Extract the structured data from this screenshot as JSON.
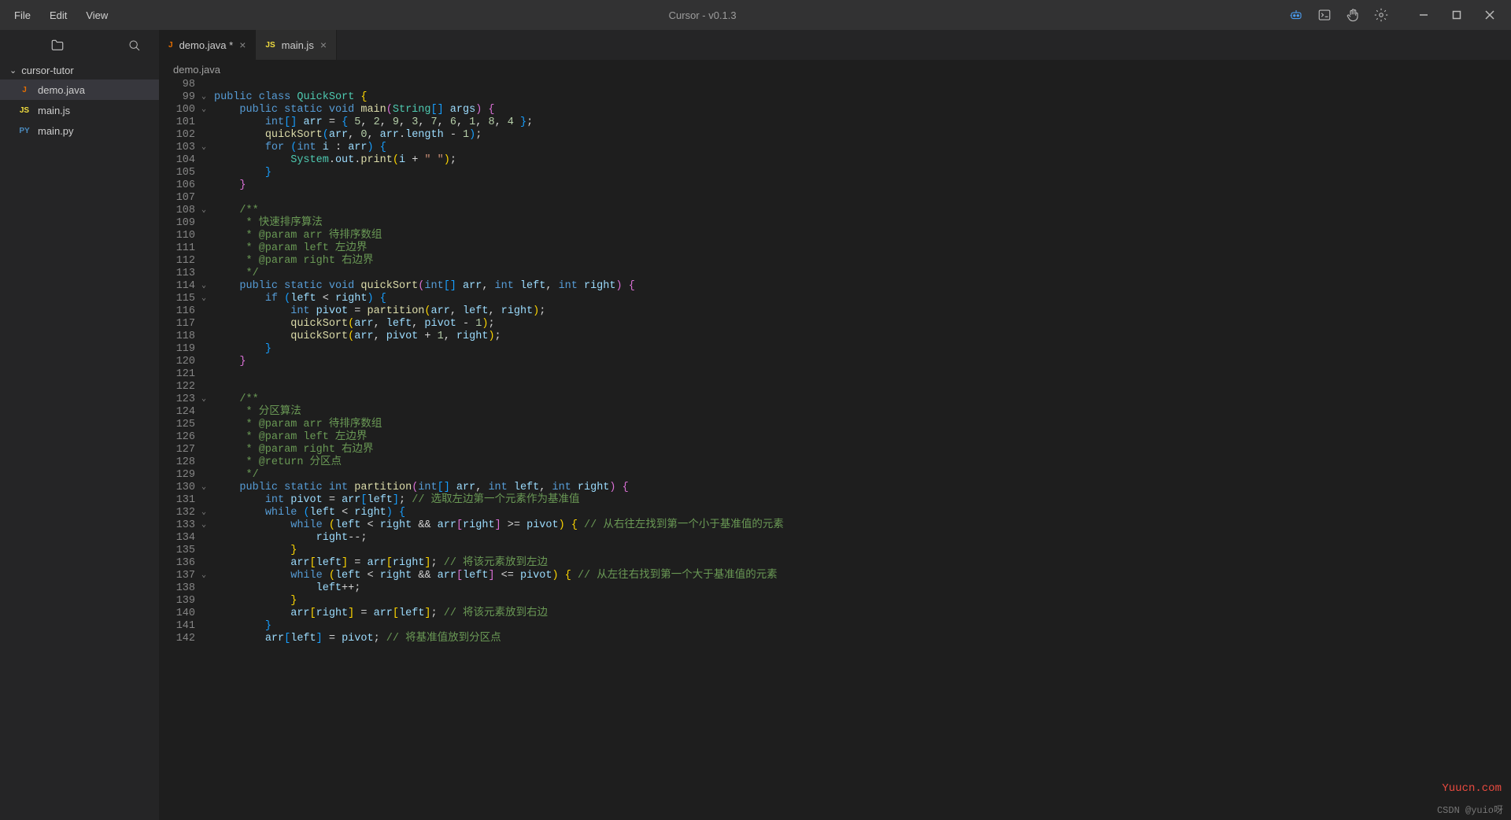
{
  "title": "Cursor - v0.1.3",
  "menu": {
    "file": "File",
    "edit": "Edit",
    "view": "View"
  },
  "sidebar": {
    "folder": "cursor-tutor",
    "files": [
      {
        "lang": "J",
        "name": "demo.java",
        "cls": "lang-j"
      },
      {
        "lang": "JS",
        "name": "main.js",
        "cls": "lang-js"
      },
      {
        "lang": "PY",
        "name": "main.py",
        "cls": "lang-py"
      }
    ]
  },
  "tabs": [
    {
      "lang": "J",
      "cls": "lang-j",
      "label": "demo.java *",
      "active": true
    },
    {
      "lang": "JS",
      "cls": "lang-js",
      "label": "main.js",
      "active": false
    }
  ],
  "breadcrumb": "demo.java",
  "line_start": 98,
  "line_end": 142,
  "fold_lines": [
    99,
    100,
    103,
    108,
    114,
    115,
    123,
    130,
    132,
    133,
    137
  ],
  "code": [
    "",
    "<span class='kw'>public</span> <span class='kw'>class</span> <span class='cls'>QuickSort</span> <span class='brace-y'>{</span>",
    "    <span class='kw'>public</span> <span class='kw'>static</span> <span class='kw'>void</span> <span class='fn'>main</span><span class='brace-p'>(</span><span class='cls'>String</span><span class='brace-b'>[]</span> <span class='param'>args</span><span class='brace-p'>)</span> <span class='brace-p'>{</span>",
    "        <span class='type'>int</span><span class='brace-b'>[]</span> <span class='param'>arr</span> <span class='op'>=</span> <span class='brace-b'>{</span> <span class='num'>5</span>, <span class='num'>2</span>, <span class='num'>9</span>, <span class='num'>3</span>, <span class='num'>7</span>, <span class='num'>6</span>, <span class='num'>1</span>, <span class='num'>8</span>, <span class='num'>4</span> <span class='brace-b'>}</span>;",
    "        <span class='fn'>quickSort</span><span class='brace-b'>(</span><span class='param'>arr</span>, <span class='num'>0</span>, <span class='param'>arr</span>.<span class='field'>length</span> <span class='op'>-</span> <span class='num'>1</span><span class='brace-b'>)</span>;",
    "        <span class='kw'>for</span> <span class='brace-b'>(</span><span class='type'>int</span> <span class='param'>i</span> <span class='op'>:</span> <span class='param'>arr</span><span class='brace-b'>)</span> <span class='brace-b'>{</span>",
    "            <span class='cls'>System</span>.<span class='field'>out</span>.<span class='fn'>print</span><span class='brace-y'>(</span><span class='param'>i</span> <span class='op'>+</span> <span class='str'>\" \"</span><span class='brace-y'>)</span>;",
    "        <span class='brace-b'>}</span>",
    "    <span class='brace-p'>}</span>",
    "",
    "    <span class='cmt'>/**</span>",
    "<span class='cmt'>     * 快速排序算法</span>",
    "<span class='cmt'>     * @param arr 待排序数组</span>",
    "<span class='cmt'>     * @param left 左边界</span>",
    "<span class='cmt'>     * @param right 右边界</span>",
    "<span class='cmt'>     */</span>",
    "    <span class='kw'>public</span> <span class='kw'>static</span> <span class='kw'>void</span> <span class='fn'>quickSort</span><span class='brace-p'>(</span><span class='type'>int</span><span class='brace-b'>[]</span> <span class='param'>arr</span>, <span class='type'>int</span> <span class='param'>left</span>, <span class='type'>int</span> <span class='param'>right</span><span class='brace-p'>)</span> <span class='brace-p'>{</span>",
    "        <span class='kw'>if</span> <span class='brace-b'>(</span><span class='param'>left</span> <span class='op'>&lt;</span> <span class='param'>right</span><span class='brace-b'>)</span> <span class='brace-b'>{</span>",
    "            <span class='type'>int</span> <span class='param'>pivot</span> <span class='op'>=</span> <span class='fn'>partition</span><span class='brace-y'>(</span><span class='param'>arr</span>, <span class='param'>left</span>, <span class='param'>right</span><span class='brace-y'>)</span>;",
    "            <span class='fn'>quickSort</span><span class='brace-y'>(</span><span class='param'>arr</span>, <span class='param'>left</span>, <span class='param'>pivot</span> <span class='op'>-</span> <span class='num'>1</span><span class='brace-y'>)</span>;",
    "            <span class='fn'>quickSort</span><span class='brace-y'>(</span><span class='param'>arr</span>, <span class='param'>pivot</span> <span class='op'>+</span> <span class='num'>1</span>, <span class='param'>right</span><span class='brace-y'>)</span>;",
    "        <span class='brace-b'>}</span>",
    "    <span class='brace-p'>}</span>",
    "",
    "",
    "    <span class='cmt'>/**</span>",
    "<span class='cmt'>     * 分区算法</span>",
    "<span class='cmt'>     * @param arr 待排序数组</span>",
    "<span class='cmt'>     * @param left 左边界</span>",
    "<span class='cmt'>     * @param right 右边界</span>",
    "<span class='cmt'>     * @return 分区点</span>",
    "<span class='cmt'>     */</span>",
    "    <span class='kw'>public</span> <span class='kw'>static</span> <span class='type'>int</span> <span class='fn'>partition</span><span class='brace-p'>(</span><span class='type'>int</span><span class='brace-b'>[]</span> <span class='param'>arr</span>, <span class='type'>int</span> <span class='param'>left</span>, <span class='type'>int</span> <span class='param'>right</span><span class='brace-p'>)</span> <span class='brace-p'>{</span>",
    "        <span class='type'>int</span> <span class='param'>pivot</span> <span class='op'>=</span> <span class='param'>arr</span><span class='brace-b'>[</span><span class='param'>left</span><span class='brace-b'>]</span>; <span class='cmt'>// 选取左边第一个元素作为基准值</span>",
    "        <span class='kw'>while</span> <span class='brace-b'>(</span><span class='param'>left</span> <span class='op'>&lt;</span> <span class='param'>right</span><span class='brace-b'>)</span> <span class='brace-b'>{</span>",
    "            <span class='kw'>while</span> <span class='brace-y'>(</span><span class='param'>left</span> <span class='op'>&lt;</span> <span class='param'>right</span> <span class='op'>&amp;&amp;</span> <span class='param'>arr</span><span class='brace-p'>[</span><span class='param'>right</span><span class='brace-p'>]</span> <span class='op'>&gt;=</span> <span class='param'>pivot</span><span class='brace-y'>)</span> <span class='brace-y'>{</span> <span class='cmt'>// 从右往左找到第一个小于基准值的元素</span>",
    "                <span class='param'>right</span><span class='op'>--</span>;",
    "            <span class='brace-y'>}</span>",
    "            <span class='param'>arr</span><span class='brace-y'>[</span><span class='param'>left</span><span class='brace-y'>]</span> <span class='op'>=</span> <span class='param'>arr</span><span class='brace-y'>[</span><span class='param'>right</span><span class='brace-y'>]</span>; <span class='cmt'>// 将该元素放到左边</span>",
    "            <span class='kw'>while</span> <span class='brace-y'>(</span><span class='param'>left</span> <span class='op'>&lt;</span> <span class='param'>right</span> <span class='op'>&amp;&amp;</span> <span class='param'>arr</span><span class='brace-p'>[</span><span class='param'>left</span><span class='brace-p'>]</span> <span class='op'>&lt;=</span> <span class='param'>pivot</span><span class='brace-y'>)</span> <span class='brace-y'>{</span> <span class='cmt'>// 从左往右找到第一个大于基准值的元素</span>",
    "                <span class='param'>left</span><span class='op'>++</span>;",
    "            <span class='brace-y'>}</span>",
    "            <span class='param'>arr</span><span class='brace-y'>[</span><span class='param'>right</span><span class='brace-y'>]</span> <span class='op'>=</span> <span class='param'>arr</span><span class='brace-y'>[</span><span class='param'>left</span><span class='brace-y'>]</span>; <span class='cmt'>// 将该元素放到右边</span>",
    "        <span class='brace-b'>}</span>",
    "        <span class='param'>arr</span><span class='brace-b'>[</span><span class='param'>left</span><span class='brace-b'>]</span> <span class='op'>=</span> <span class='param'>pivot</span>; <span class='cmt'>// 将基准值放到分区点</span>"
  ],
  "watermark1": "Yuucn.com",
  "watermark2": "CSDN @yuio呀"
}
